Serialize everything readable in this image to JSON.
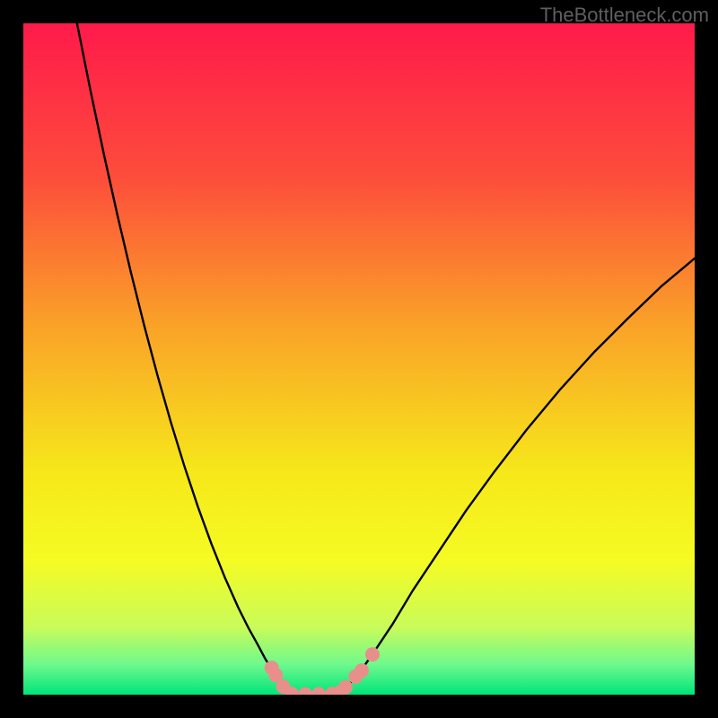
{
  "watermark": "TheBottleneck.com",
  "chart_data": {
    "type": "line",
    "title": "",
    "xlabel": "",
    "ylabel": "",
    "xlim": [
      0,
      100
    ],
    "ylim": [
      0,
      100
    ],
    "grid": false,
    "legend": false,
    "gradient_stops": [
      {
        "offset": 0.0,
        "color": "#ff1a4b"
      },
      {
        "offset": 0.23,
        "color": "#fd4d3b"
      },
      {
        "offset": 0.45,
        "color": "#faa228"
      },
      {
        "offset": 0.67,
        "color": "#f6e81a"
      },
      {
        "offset": 0.8,
        "color": "#f5fb23"
      },
      {
        "offset": 0.9,
        "color": "#c9fb5a"
      },
      {
        "offset": 0.955,
        "color": "#6ef98d"
      },
      {
        "offset": 1.0,
        "color": "#00e47a"
      }
    ],
    "series": [
      {
        "name": "left-curve",
        "color": "#000000",
        "x": [
          8,
          10,
          12,
          14,
          16,
          18,
          20,
          22,
          24,
          26,
          28,
          30,
          32,
          33.5,
          35,
          36,
          37,
          37.8,
          38.4,
          38.9,
          39.3,
          39.7
        ],
        "y": [
          100,
          90,
          80.5,
          71.5,
          63,
          55,
          47.5,
          40.5,
          34,
          28,
          22.5,
          17.5,
          13,
          10,
          7.3,
          5.4,
          3.8,
          2.6,
          1.7,
          1.0,
          0.5,
          0.15
        ]
      },
      {
        "name": "valley-floor",
        "color": "#000000",
        "x": [
          39.7,
          41,
          43,
          45,
          46,
          46.7
        ],
        "y": [
          0.15,
          0.08,
          0.05,
          0.07,
          0.1,
          0.15
        ]
      },
      {
        "name": "right-curve",
        "color": "#000000",
        "x": [
          46.7,
          47.5,
          48.5,
          50,
          52,
          55,
          58,
          62,
          66,
          70,
          75,
          80,
          85,
          90,
          95,
          100
        ],
        "y": [
          0.15,
          0.6,
          1.5,
          3.2,
          6,
          10.5,
          15.5,
          21.5,
          27.5,
          33,
          39.5,
          45.5,
          51,
          56,
          60.8,
          65
        ]
      }
    ],
    "markers": {
      "color": "#e88f8c",
      "radius_px": 8,
      "points": [
        {
          "x": 37.0,
          "y": 4.0
        },
        {
          "x": 37.6,
          "y": 2.9
        },
        {
          "x": 38.7,
          "y": 1.2
        },
        {
          "x": 40.0,
          "y": 0.1
        },
        {
          "x": 42.0,
          "y": 0.05
        },
        {
          "x": 44.0,
          "y": 0.08
        },
        {
          "x": 46.0,
          "y": 0.1
        },
        {
          "x": 47.2,
          "y": 0.35
        },
        {
          "x": 48.0,
          "y": 1.1
        },
        {
          "x": 49.5,
          "y": 2.7
        },
        {
          "x": 50.4,
          "y": 3.6
        },
        {
          "x": 52.0,
          "y": 6.0
        }
      ]
    }
  }
}
